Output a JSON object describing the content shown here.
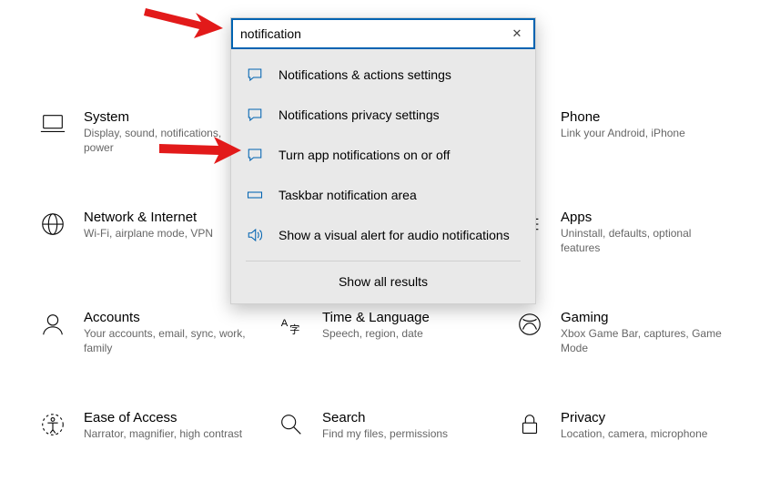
{
  "search": {
    "value": "notification",
    "results": [
      {
        "label": "Notifications & actions settings",
        "icon": "speech"
      },
      {
        "label": "Notifications privacy settings",
        "icon": "speech"
      },
      {
        "label": "Turn app notifications on or off",
        "icon": "speech"
      },
      {
        "label": "Taskbar notification area",
        "icon": "taskbar"
      },
      {
        "label": "Show a visual alert for audio notifications",
        "icon": "volume"
      }
    ],
    "show_all": "Show all results"
  },
  "categories": {
    "system": {
      "title": "System",
      "sub": "Display, sound, notifications, power"
    },
    "devices": {
      "title": "",
      "sub": ""
    },
    "phone": {
      "title": "Phone",
      "sub": "Link your Android, iPhone"
    },
    "network": {
      "title": "Network & Internet",
      "sub": "Wi-Fi, airplane mode, VPN"
    },
    "personal": {
      "title": "",
      "sub": ""
    },
    "apps": {
      "title": "Apps",
      "sub": "Uninstall, defaults, optional features"
    },
    "accounts": {
      "title": "Accounts",
      "sub": "Your accounts, email, sync, work, family"
    },
    "time": {
      "title": "Time & Language",
      "sub": "Speech, region, date"
    },
    "gaming": {
      "title": "Gaming",
      "sub": "Xbox Game Bar, captures, Game Mode"
    },
    "ease": {
      "title": "Ease of Access",
      "sub": "Narrator, magnifier, high contrast"
    },
    "searchcat": {
      "title": "Search",
      "sub": "Find my files, permissions"
    },
    "privacy": {
      "title": "Privacy",
      "sub": "Location, camera, microphone"
    }
  }
}
